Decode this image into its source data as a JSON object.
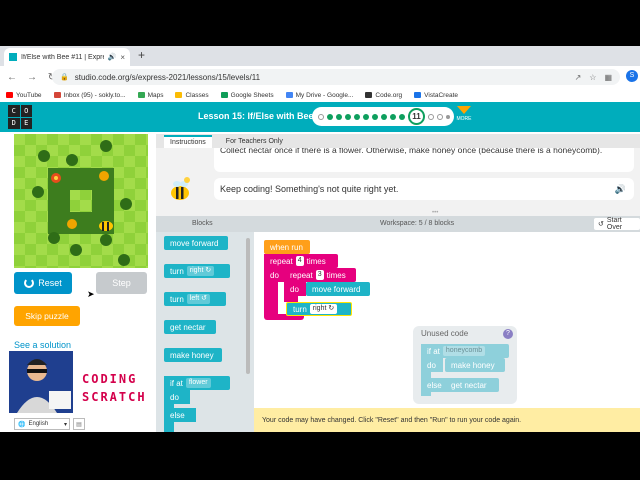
{
  "browser": {
    "tab_title": "If/Else with Bee #11 | Express",
    "url": "studio.code.org/s/express-2021/lessons/15/levels/11",
    "bookmarks": [
      {
        "label": "YouTube",
        "color": "#ff0000"
      },
      {
        "label": "Inbox (95) - sokly.to...",
        "color": "#d44638"
      },
      {
        "label": "Maps",
        "color": "#34a853"
      },
      {
        "label": "Classes",
        "color": "#fbbc04"
      },
      {
        "label": "Google Sheets",
        "color": "#0f9d58"
      },
      {
        "label": "My Drive - Google...",
        "color": "#4285f4"
      },
      {
        "label": "Code.org",
        "color": "#333333"
      },
      {
        "label": "VistaCreate",
        "color": "#1a73e8"
      }
    ]
  },
  "header": {
    "logo_letters": [
      "C",
      "O",
      "D",
      "E"
    ],
    "lesson_title": "Lesson 15: If/Else with Bee",
    "current_level": "11",
    "more_label": "MORE",
    "accent_color": "#00adbc"
  },
  "left_panel": {
    "reset_label": "Reset",
    "step_label": "Step",
    "skip_label": "Skip puzzle",
    "see_solution": "See a solution",
    "overlay_text": "CODING SCRATCH",
    "language": "English"
  },
  "instructions": {
    "tabs": [
      "Instructions",
      "For Teachers Only"
    ],
    "text1": "Collect nectar once if there is a flower. Otherwise, make honey once (because there is a honeycomb).",
    "text2": "Keep coding! Something's not quite right yet."
  },
  "workspace": {
    "blocks_header": "Blocks",
    "workspace_header": "Workspace: 5 / 8 blocks",
    "start_over": "Start Over",
    "warning": "Your code may have changed. Click \"Reset\" and then \"Run\" to run your code again.",
    "unused_label": "Unused code"
  },
  "toolbox": {
    "move_forward": "move forward",
    "turn": "turn",
    "right": "right ↻",
    "left": "left ↺",
    "get_nectar": "get nectar",
    "make_honey": "make honey",
    "if_at": "if at",
    "flower": "flower",
    "do": "do",
    "else": "else"
  },
  "program": {
    "when_run": "when run",
    "repeat": "repeat",
    "times": "times",
    "outer_count": "4",
    "inner_count": "3",
    "do": "do",
    "move_forward": "move forward",
    "turn": "turn",
    "right": "right ↻"
  },
  "unused_block": {
    "if_at": "if at",
    "honeycomb": "honeycomb",
    "do": "do",
    "make_honey": "make honey",
    "else": "else",
    "get_nectar": "get nectar"
  }
}
